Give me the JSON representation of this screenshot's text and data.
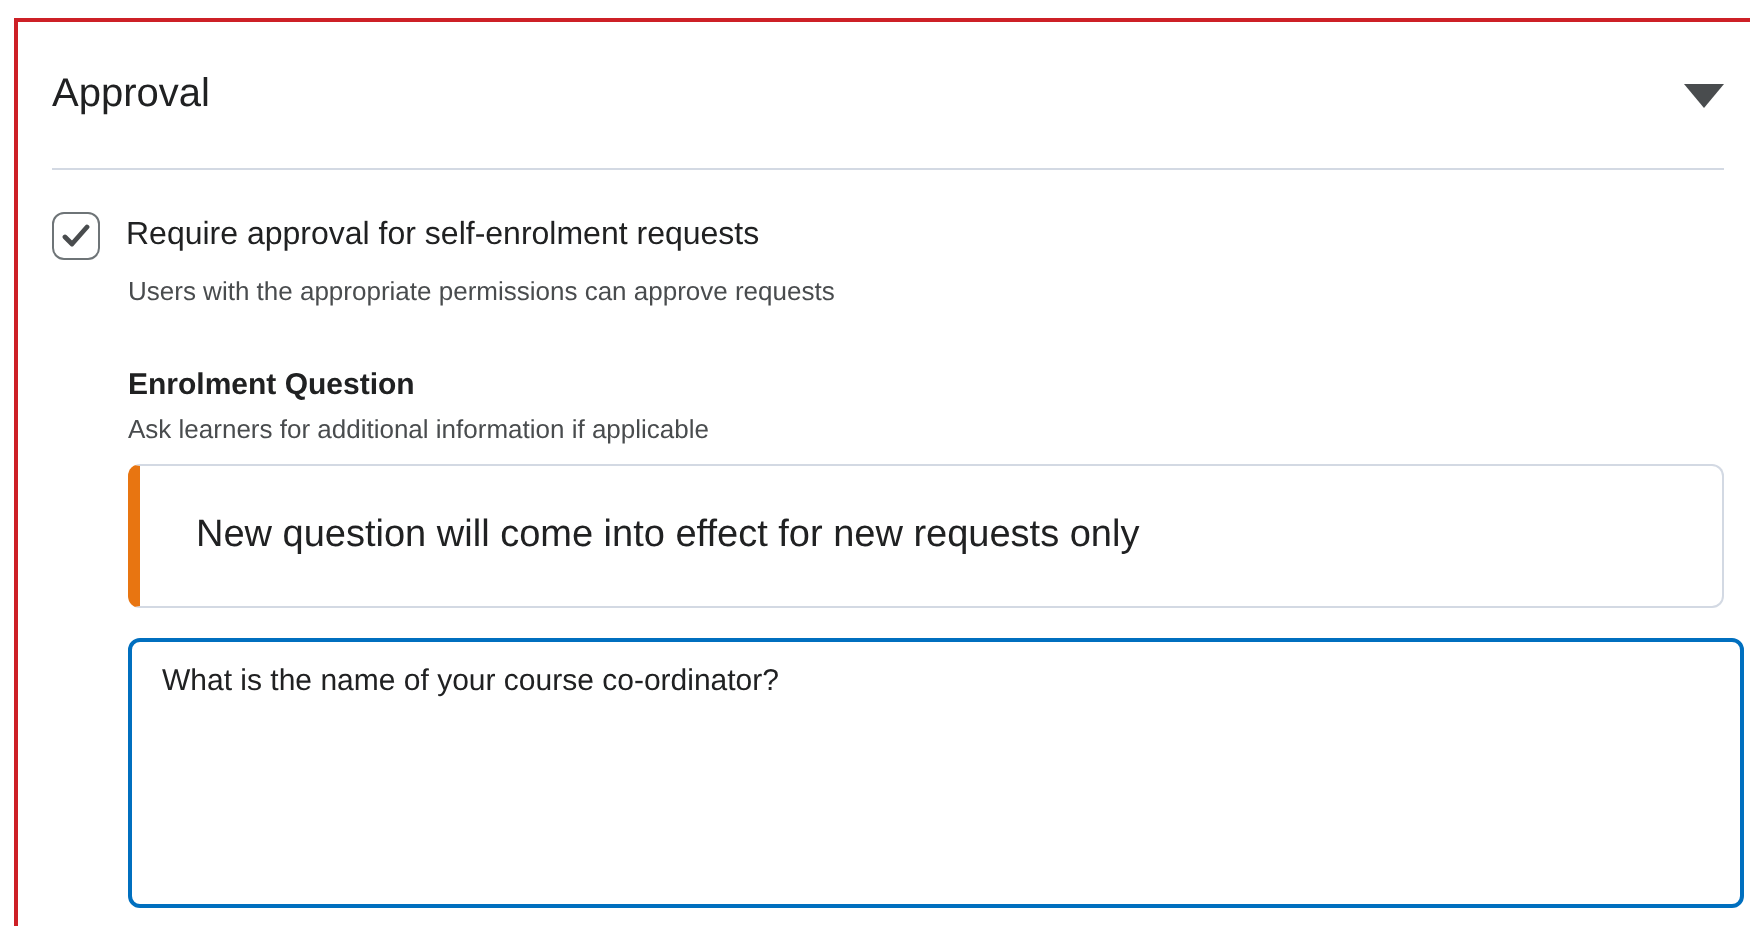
{
  "section": {
    "title": "Approval",
    "expanded": true
  },
  "approval": {
    "label": "Require approval for self-enrolment requests",
    "checked": true,
    "help": "Users with the appropriate permissions can approve requests"
  },
  "question": {
    "heading": "Enrolment Question",
    "help": "Ask learners for additional information if applicable",
    "alert": {
      "text": "New question will come into effect for new requests only"
    },
    "value": "What is the name of your course co-ordinator?",
    "focused": true
  }
}
